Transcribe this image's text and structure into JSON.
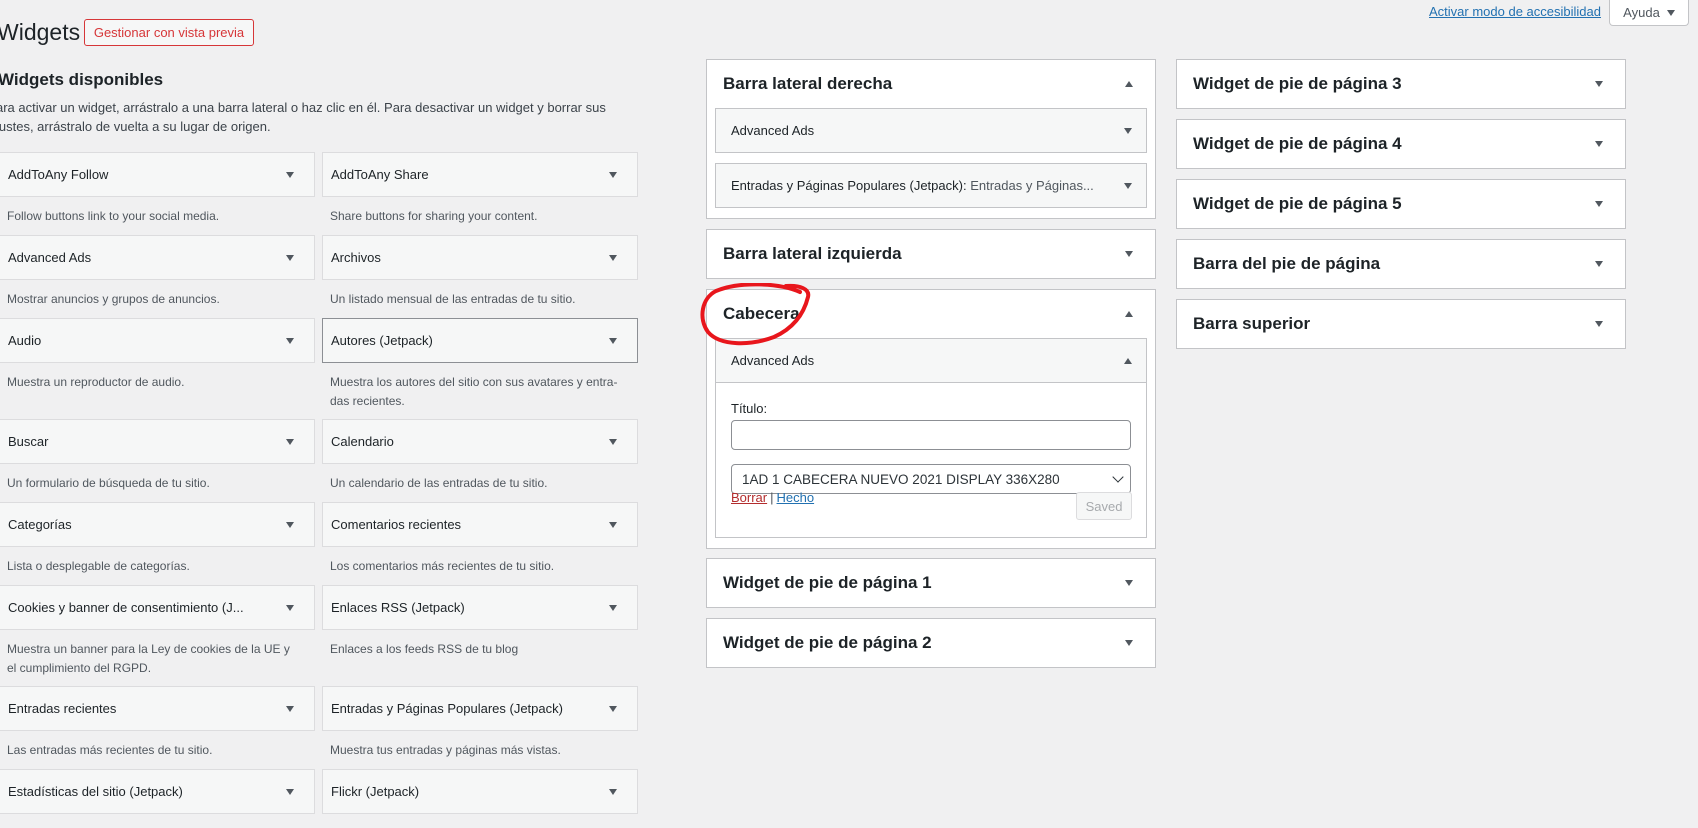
{
  "header": {
    "title": "Widgets",
    "preview_button": "Gestionar con vista previa",
    "accessibility_link": "Activar modo de accesibilidad",
    "help_button": "Ayuda"
  },
  "available": {
    "title": "Widgets disponibles",
    "description": "ara activar un widget, arrástralo a una barra lateral o haz clic en él. Para desactivar un widget y borrar sus justes, arrástralo de vuelta a su lugar de origen.",
    "widgets": [
      {
        "label": "AddToAny Follow",
        "desc": "Follow buttons link to your social media."
      },
      {
        "label": "AddToAny Share",
        "desc": "Share buttons for sharing your content."
      },
      {
        "label": "Advanced Ads",
        "desc": "Mostrar anuncios y grupos de anuncios."
      },
      {
        "label": "Archivos",
        "desc": "Un listado mensual de las entradas de tu sitio."
      },
      {
        "label": "Audio",
        "desc": "Muestra un reproductor de audio."
      },
      {
        "label": "Autores (Jetpack)",
        "desc": "Muestra los autores del sitio con sus avatares y entra-das recientes."
      },
      {
        "label": "Buscar",
        "desc": "Un formulario de búsqueda de tu sitio."
      },
      {
        "label": "Calendario",
        "desc": "Un calendario de las entradas de tu sitio."
      },
      {
        "label": "Categorías",
        "desc": "Lista o desplegable de categorías."
      },
      {
        "label": "Comentarios recientes",
        "desc": "Los comentarios más recientes de tu sitio."
      },
      {
        "label": "Cookies y banner de consentimiento (J...",
        "desc": "Muestra un banner para la Ley de cookies de la UE y el cumplimiento del RGPD."
      },
      {
        "label": "Enlaces RSS (Jetpack)",
        "desc": "Enlaces a los feeds RSS de tu blog"
      },
      {
        "label": "Entradas recientes",
        "desc": "Las entradas más recientes de tu sitio."
      },
      {
        "label": "Entradas y Páginas Populares (Jetpack)",
        "desc": "Muestra tus entradas y páginas más vistas."
      },
      {
        "label": "Estadísticas del sitio (Jetpack)",
        "desc": ""
      },
      {
        "label": "Flickr (Jetpack)",
        "desc": ""
      }
    ]
  },
  "sidebars": {
    "right": {
      "title": "Barra lateral derecha",
      "widgets": [
        {
          "label": "Advanced Ads",
          "sub": ""
        },
        {
          "label": "Entradas y Páginas Populares (Jetpack):",
          "sub": "Entradas y Páginas..."
        }
      ]
    },
    "left": {
      "title": "Barra lateral izquierda"
    },
    "header": {
      "title": "Cabecera",
      "widget_label": "Advanced Ads",
      "title_field_label": "Título:",
      "title_field_value": "",
      "select_value": "1AD 1 CABECERA NUEVO 2021 DISPLAY 336X280",
      "delete_link": "Borrar",
      "separator": "|",
      "done_link": "Hecho",
      "saved_button": "Saved"
    },
    "footer1": {
      "title": "Widget de pie de página 1"
    },
    "footer2": {
      "title": "Widget de pie de página 2"
    },
    "footer3": {
      "title": "Widget de pie de página 3"
    },
    "footer4": {
      "title": "Widget de pie de página 4"
    },
    "footer5": {
      "title": "Widget de pie de página 5"
    },
    "footer_bar": {
      "title": "Barra del pie de página"
    },
    "top_bar": {
      "title": "Barra superior"
    }
  },
  "colors": {
    "annotation": "#e8161c",
    "link": "#2271b1",
    "delete": "#b32d2e"
  }
}
